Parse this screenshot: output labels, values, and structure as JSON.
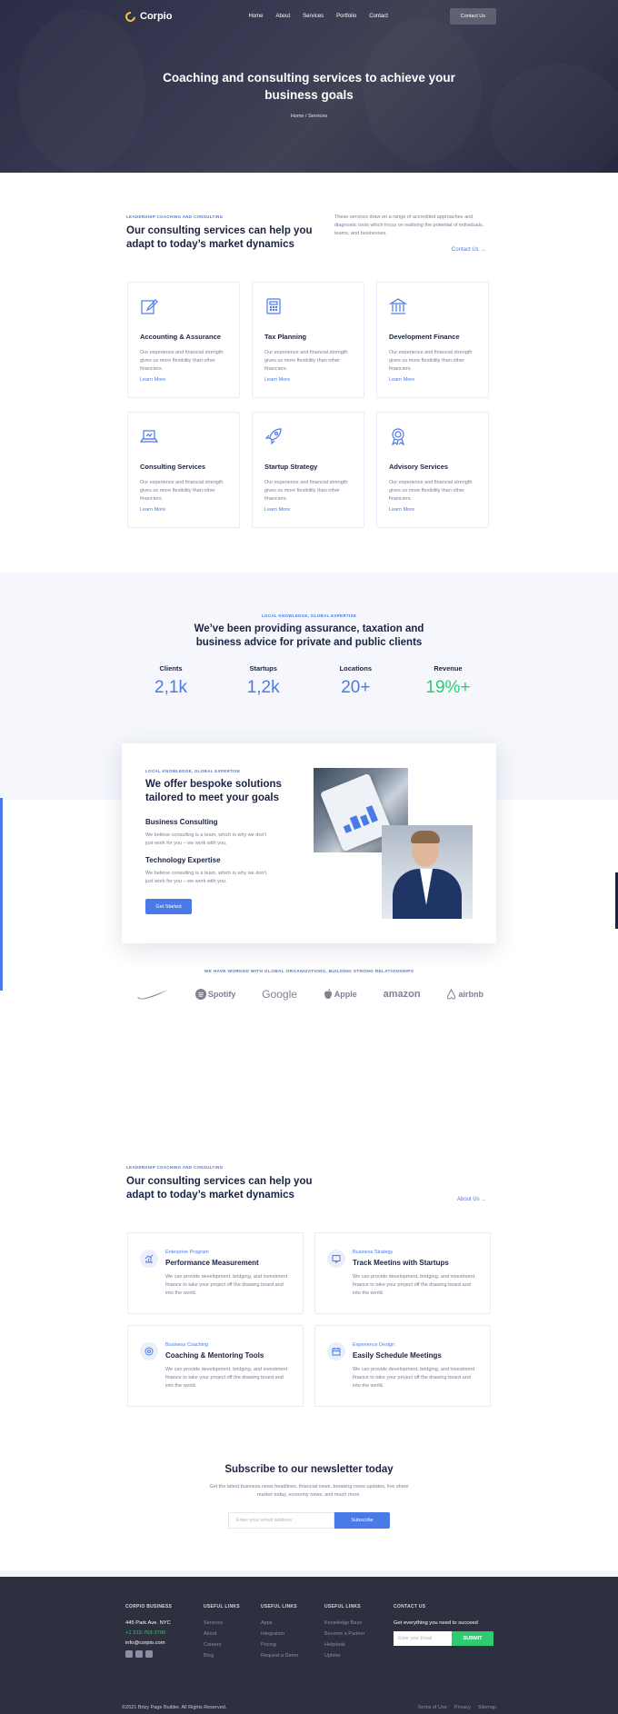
{
  "nav": {
    "logo": "Corpio",
    "links": [
      "Home",
      "About",
      "Services",
      "Portfolio",
      "Contact"
    ],
    "cta": "Contact Us"
  },
  "hero": {
    "title": "Coaching and consulting services to achieve your business goals",
    "breadcrumb": "Home / Services"
  },
  "intro": {
    "eyebrow": "LEADERSHIP COACHING AND CONSULTING",
    "title": "Our consulting services can help you adapt to today’s market dynamics",
    "description": "These services draw on a range of accredited approaches and diagnostic tools which focus on realising the potential of individuals, teams, and businesses.",
    "contact_link": "Contact Us →"
  },
  "services": [
    {
      "icon": "edit-icon",
      "title": "Accounting & Assurance",
      "desc": "Our experience and financial strength gives us more flexibility than other financiers.",
      "link": "Learn More"
    },
    {
      "icon": "calculator-icon",
      "title": "Tax Planning",
      "desc": "Our experience and financial strength gives us more flexibility than other financiers.",
      "link": "Learn More"
    },
    {
      "icon": "bank-icon",
      "title": "Development Finance",
      "desc": "Our experience and financial strength gives us more flexibility than other financiers.",
      "link": "Learn More"
    },
    {
      "icon": "laptop-icon",
      "title": "Consulting Services",
      "desc": "Our experience and financial strength gives us more flexibility than other financiers.",
      "link": "Learn More"
    },
    {
      "icon": "rocket-icon",
      "title": "Startup Strategy",
      "desc": "Our experience and financial strength gives us more flexibility than other financiers.",
      "link": "Learn More"
    },
    {
      "icon": "award-icon",
      "title": "Advisory Services",
      "desc": "Our experience and financial strength gives us more flexibility than other financiers.",
      "link": "Learn More"
    }
  ],
  "stats": {
    "eyebrow": "LOCAL KNOWLEDGE, GLOBAL EXPERTISE",
    "title": "We’ve been providing assurance, taxation and business advice for private and public clients",
    "items": [
      {
        "label": "Clients",
        "value": "2,1k"
      },
      {
        "label": "Startups",
        "value": "1,2k"
      },
      {
        "label": "Locations",
        "value": "20+"
      },
      {
        "label": "Revenue",
        "value": "19%+"
      }
    ]
  },
  "bespoke": {
    "eyebrow": "LOCAL KNOWLEDGE, GLOBAL EXPERTISE",
    "title": "We offer bespoke solutions tailored to meet your goals",
    "sub1": "Business Consulting",
    "desc1": "We believe consulting is a team, which is why we don't just work for you – we work with you.",
    "sub2": "Technology Expertise",
    "desc2": "We believe consulting is a team, which is why we don't just work for you – we work with you.",
    "button": "Get Started"
  },
  "partners": {
    "label": "WE HAVE WORKED WITH GLOBAL ORGANIZATIONS, BUILDING STRONG RELATIONSHIPS",
    "logos": [
      "Spotify",
      "Google",
      "Apple",
      "amazon",
      "airbnb"
    ]
  },
  "features": {
    "eyebrow": "LEADERSHIP COACHING AND CONSULTING",
    "title": "Our consulting services can help you adapt to today’s market dynamics",
    "about_link": "About Us →",
    "items": [
      {
        "eyebrow": "Enterprise Program",
        "title": "Performance Measurement",
        "desc": "We can provide development, bridging, and investment finance to take your project off the drawing board and into the world."
      },
      {
        "eyebrow": "Business Strategy",
        "title": "Track Meetins with Startups",
        "desc": "We can provide development, bridging, and investment finance to take your project off the drawing board and into the world."
      },
      {
        "eyebrow": "Business Coaching",
        "title": "Coaching & Mentoring Tools",
        "desc": "We can provide development, bridging, and investment finance to take your project off the drawing board and into the world."
      },
      {
        "eyebrow": "Experience Design",
        "title": "Easily Schedule Meetings",
        "desc": "We can provide development, bridging, and investment finance to take your project off the drawing board and into the world."
      }
    ]
  },
  "newsletter": {
    "title": "Subscribe to our newsletter today",
    "desc": "Get the latest business news headlines, financial news, breaking news updates, live share market today, economy news, and much more.",
    "placeholder": "Enter your email address",
    "button": "Subscribe"
  },
  "footer": {
    "brand_head": "CORPIO BUSINESS",
    "address": "445 Park Ave. NYC",
    "phone": "+1 212-763-3700",
    "email": "info@corpio.com",
    "col1": {
      "head": "USEFUL LINKS",
      "links": [
        "Services",
        "About",
        "Careers",
        "Blog"
      ]
    },
    "col2": {
      "head": "USEFUL LINKS",
      "links": [
        "Apps",
        "Integration",
        "Pricing",
        "Request a Demo"
      ]
    },
    "col3": {
      "head": "USEFUL LINKS",
      "links": [
        "Knowledge Base",
        "Become a Partner",
        "Helpdesk",
        "Uptime"
      ]
    },
    "contact_head": "CONTACT US",
    "contact_cta": "Get everything you need to succeed",
    "placeholder": "Enter your Email",
    "submit": "SUBMIT",
    "copyright": "©2021 Brizy Page Builder. All Rights Reserved.",
    "legal": [
      "Terms of Use",
      "Privacy",
      "Sitemap"
    ]
  },
  "colors": {
    "accent": "#4a7ae8",
    "green": "#2ecc71",
    "dark": "#1b2343",
    "footer": "#2e2f3f"
  }
}
